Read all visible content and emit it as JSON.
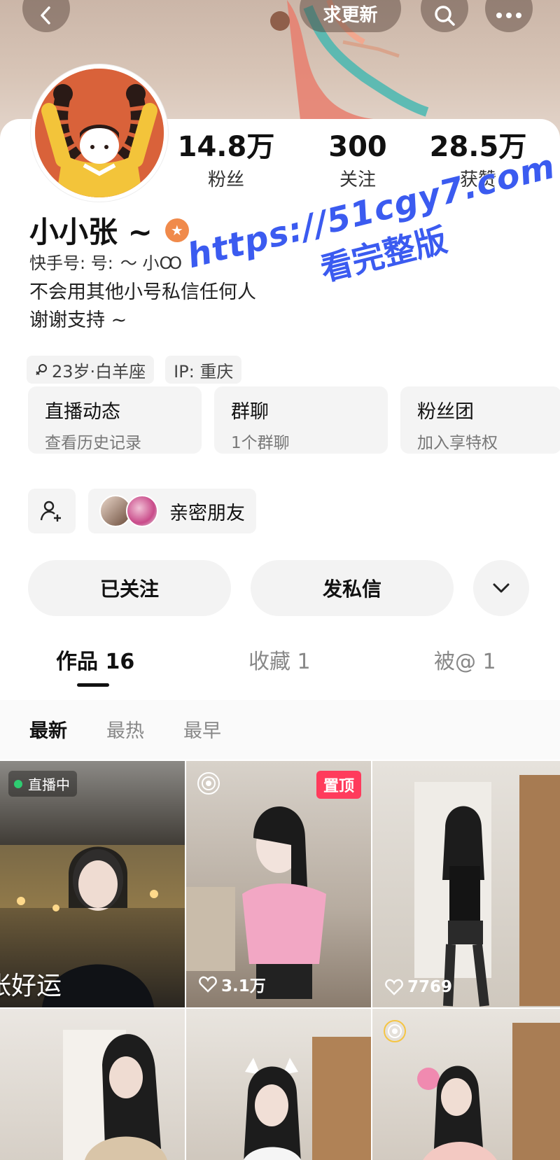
{
  "colors": {
    "accent": "#ff3b5c",
    "watermark": "#3b5bf0",
    "live": "#2ecc71"
  },
  "header": {
    "update_label": "求更新"
  },
  "stats": [
    {
      "value": "14.8万",
      "label": "粉丝"
    },
    {
      "value": "300",
      "label": "关注"
    },
    {
      "value": "28.5万",
      "label": "获赞"
    }
  ],
  "profile": {
    "name": "小小张 ~",
    "account_prefix": "快手号: 号:",
    "account_value": "〜 小Ꚙ",
    "bio_line1": "不会用其他小号私信任何人",
    "bio_line2": "谢谢支持 ~",
    "tag_age": "23岁·白羊座",
    "tag_ip": "IP: 重庆"
  },
  "features": [
    {
      "title": "直播动态",
      "sub": "查看历史记录"
    },
    {
      "title": "群聊",
      "sub": "1个群聊"
    },
    {
      "title": "粉丝团",
      "sub": "加入享特权"
    }
  ],
  "close_friends_label": "亲密朋友",
  "actions": {
    "follow": "已关注",
    "message": "发私信"
  },
  "tabs": [
    "作品 16",
    "收藏 1",
    "被@ 1"
  ],
  "sorts": [
    "最新",
    "最热",
    "最早"
  ],
  "grid": [
    {
      "badge": "直播中",
      "caption": "张好运"
    },
    {
      "pin": "置顶",
      "likes": "3.1万"
    },
    {
      "likes": "7769"
    },
    {},
    {},
    {}
  ],
  "watermark": {
    "line1": "https://51cgy7.com",
    "line2": "看完整版"
  }
}
